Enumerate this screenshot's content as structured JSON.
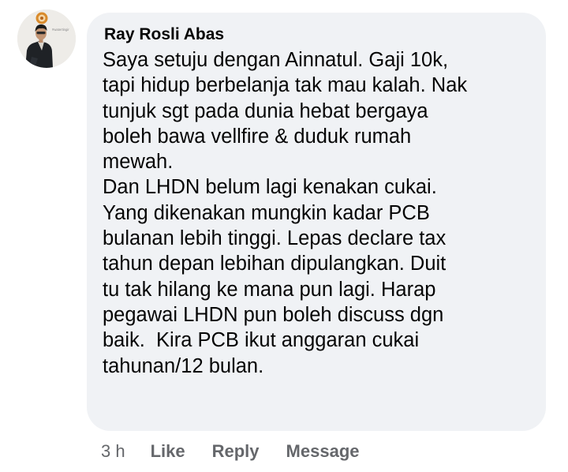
{
  "comment": {
    "avatar_watermark": "#watertingir",
    "author": "Ray Rosli Abas",
    "lines": [
      "Saya setuju dengan Ainnatul. Gaji 10k,",
      "tapi hidup berbelanja tak mau kalah. Nak",
      "tunjuk sgt pada dunia hebat bergaya",
      "boleh bawa vellfire & duduk rumah",
      "mewah.",
      "Dan LHDN belum lagi kenakan cukai.",
      "Yang dikenakan mungkin kadar PCB",
      "bulanan lebih tinggi. Lepas declare tax",
      "tahun depan lebihan dipulangkan. Duit",
      "tu tak hilang ke mana pun lagi. Harap",
      "pegawai LHDN pun boleh discuss dgn",
      "baik.  Kira PCB ikut anggaran cukai",
      "tahunan/12 bulan."
    ]
  },
  "actions": {
    "timestamp": "3 h",
    "like": "Like",
    "reply": "Reply",
    "message": "Message"
  },
  "colors": {
    "bubble_background": "#f0f2f5",
    "text_primary": "#050505",
    "text_secondary": "#65676b"
  },
  "icons": {
    "avatar": "profile-photo-man-in-black-jacket",
    "avatar_logo": "round-orange-emblem"
  }
}
